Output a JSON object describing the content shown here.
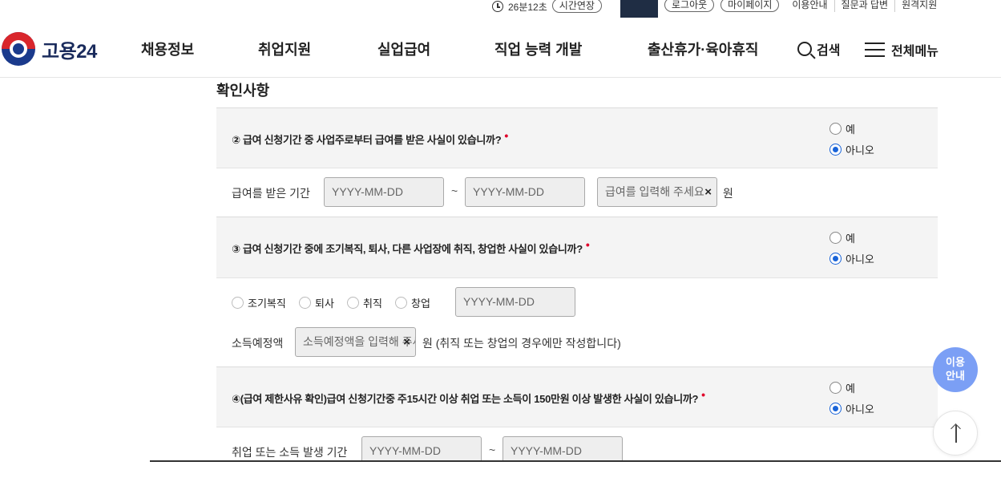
{
  "util": {
    "timer_text": "26분12초",
    "extend_label": "시간연장",
    "logout_label": "로그아웃",
    "mypage_label": "마이페이지",
    "links": [
      "이용안내",
      "질문과 답변",
      "원격지원"
    ]
  },
  "header": {
    "logo_text": "고용24",
    "nav": [
      "채용정보",
      "취업지원",
      "실업급여",
      "직업 능력 개발",
      "출산휴가·육아휴직"
    ],
    "search_label": "검색",
    "menu_label": "전체메뉴"
  },
  "section_title": "확인사항",
  "questions": [
    {
      "text": "② 급여 신청기간 중 사업주로부터 급여를 받은 사실이 있습니까?",
      "options": [
        "예",
        "아니오"
      ],
      "selected": "아니오"
    },
    {
      "text": "③ 급여 신청기간 중에 조기복직, 퇴사, 다른 사업장에 취직, 창업한 사실이 있습니까?",
      "options": [
        "예",
        "아니오"
      ],
      "selected": "아니오"
    },
    {
      "text": "④(급여 제한사유 확인)급여 신청기간중 주15시간 이상 취업 또는 소득이 150만원 이상 발생한 사실이 있습니까?",
      "options": [
        "예",
        "아니오"
      ],
      "selected": "아니오"
    }
  ],
  "required_mark": "•",
  "q2_detail": {
    "label": "급여를 받은 기간",
    "date_placeholder": "YYYY-MM-DD",
    "tilde": "~",
    "amount_placeholder": "급여를 입력해 주세요",
    "clear": "×",
    "unit": "원"
  },
  "q3_detail": {
    "types": [
      "조기복직",
      "퇴사",
      "취직",
      "창업"
    ],
    "date_placeholder": "YYYY-MM-DD",
    "income_label": "소득예정액",
    "income_placeholder": "소득예정액을 입력해 주세요",
    "clear": "×",
    "note": "원 (취직 또는 창업의 경우에만 작성합니다)"
  },
  "q4_detail": {
    "label": "취업 또는 소득 발생 기간",
    "date_placeholder": "YYYY-MM-DD",
    "tilde": "~"
  },
  "floating": {
    "guide_line1": "이용",
    "guide_line2": "안내"
  }
}
